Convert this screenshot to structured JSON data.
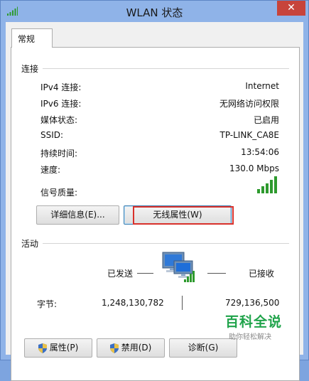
{
  "window": {
    "title": "WLAN 状态",
    "close_glyph": "✕"
  },
  "tabs": [
    {
      "label": "常规"
    }
  ],
  "connection": {
    "group_label": "连接",
    "rows": [
      {
        "label": "IPv4 连接:",
        "value": "Internet"
      },
      {
        "label": "IPv6 连接:",
        "value": "无网络访问权限"
      },
      {
        "label": "媒体状态:",
        "value": "已启用"
      },
      {
        "label": "SSID:",
        "value": "TP-LINK_CA8E"
      },
      {
        "label": "持续时间:",
        "value": "13:54:06"
      },
      {
        "label": "速度:",
        "value": "130.0 Mbps"
      },
      {
        "label": "信号质量:",
        "value": ""
      }
    ],
    "signal_bars_lit": 5,
    "signal_bars_total": 5,
    "details_button": "详细信息(E)...",
    "wireless_props_button": "无线属性(W)"
  },
  "activity": {
    "group_label": "活动",
    "sent_label": "已发送",
    "received_label": "已接收",
    "bytes_label": "字节:",
    "bytes_sent": "1,248,130,782",
    "bytes_received": "729,136,500"
  },
  "bottom_buttons": {
    "properties": "属性(P)",
    "disable": "禁用(D)",
    "diagnose": "诊断(G)"
  },
  "watermark": {
    "main": "百科全说",
    "sub": "助你轻松解决"
  },
  "colors": {
    "title_bar": "#8fb3e8",
    "close_button": "#c7443b",
    "signal_green": "#2e9a2e",
    "highlight": "#d9312b",
    "watermark": "#1fa34a"
  }
}
